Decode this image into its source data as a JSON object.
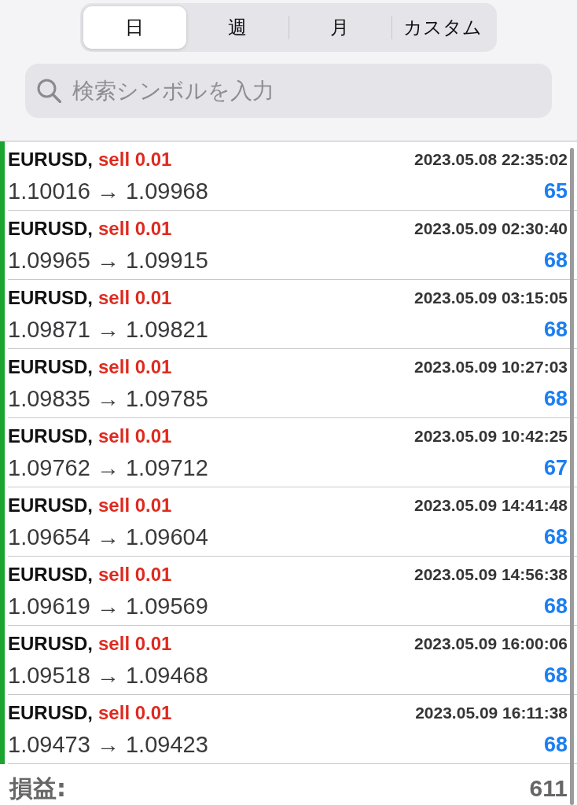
{
  "segmented_control": {
    "tabs": [
      {
        "label": "日",
        "selected": true
      },
      {
        "label": "週",
        "selected": false
      },
      {
        "label": "月",
        "selected": false
      },
      {
        "label": "カスタム",
        "selected": false
      }
    ]
  },
  "search": {
    "placeholder": "検索シンボルを入力"
  },
  "trades": [
    {
      "symbol": "EURUSD,",
      "side": "sell 0.01",
      "time": "2023.05.08 22:35:02",
      "prices": "1.10016 → 1.09968",
      "profit": "65"
    },
    {
      "symbol": "EURUSD,",
      "side": "sell 0.01",
      "time": "2023.05.09 02:30:40",
      "prices": "1.09965 → 1.09915",
      "profit": "68"
    },
    {
      "symbol": "EURUSD,",
      "side": "sell 0.01",
      "time": "2023.05.09 03:15:05",
      "prices": "1.09871 → 1.09821",
      "profit": "68"
    },
    {
      "symbol": "EURUSD,",
      "side": "sell 0.01",
      "time": "2023.05.09 10:27:03",
      "prices": "1.09835 → 1.09785",
      "profit": "68"
    },
    {
      "symbol": "EURUSD,",
      "side": "sell 0.01",
      "time": "2023.05.09 10:42:25",
      "prices": "1.09762 → 1.09712",
      "profit": "67"
    },
    {
      "symbol": "EURUSD,",
      "side": "sell 0.01",
      "time": "2023.05.09 14:41:48",
      "prices": "1.09654 → 1.09604",
      "profit": "68"
    },
    {
      "symbol": "EURUSD,",
      "side": "sell 0.01",
      "time": "2023.05.09 14:56:38",
      "prices": "1.09619 → 1.09569",
      "profit": "68"
    },
    {
      "symbol": "EURUSD,",
      "side": "sell 0.01",
      "time": "2023.05.09 16:00:06",
      "prices": "1.09518 → 1.09468",
      "profit": "68"
    },
    {
      "symbol": "EURUSD,",
      "side": "sell 0.01",
      "time": "2023.05.09 16:11:38",
      "prices": "1.09473 → 1.09423",
      "profit": "68"
    }
  ],
  "total": {
    "label": "損益:",
    "value": "611"
  }
}
